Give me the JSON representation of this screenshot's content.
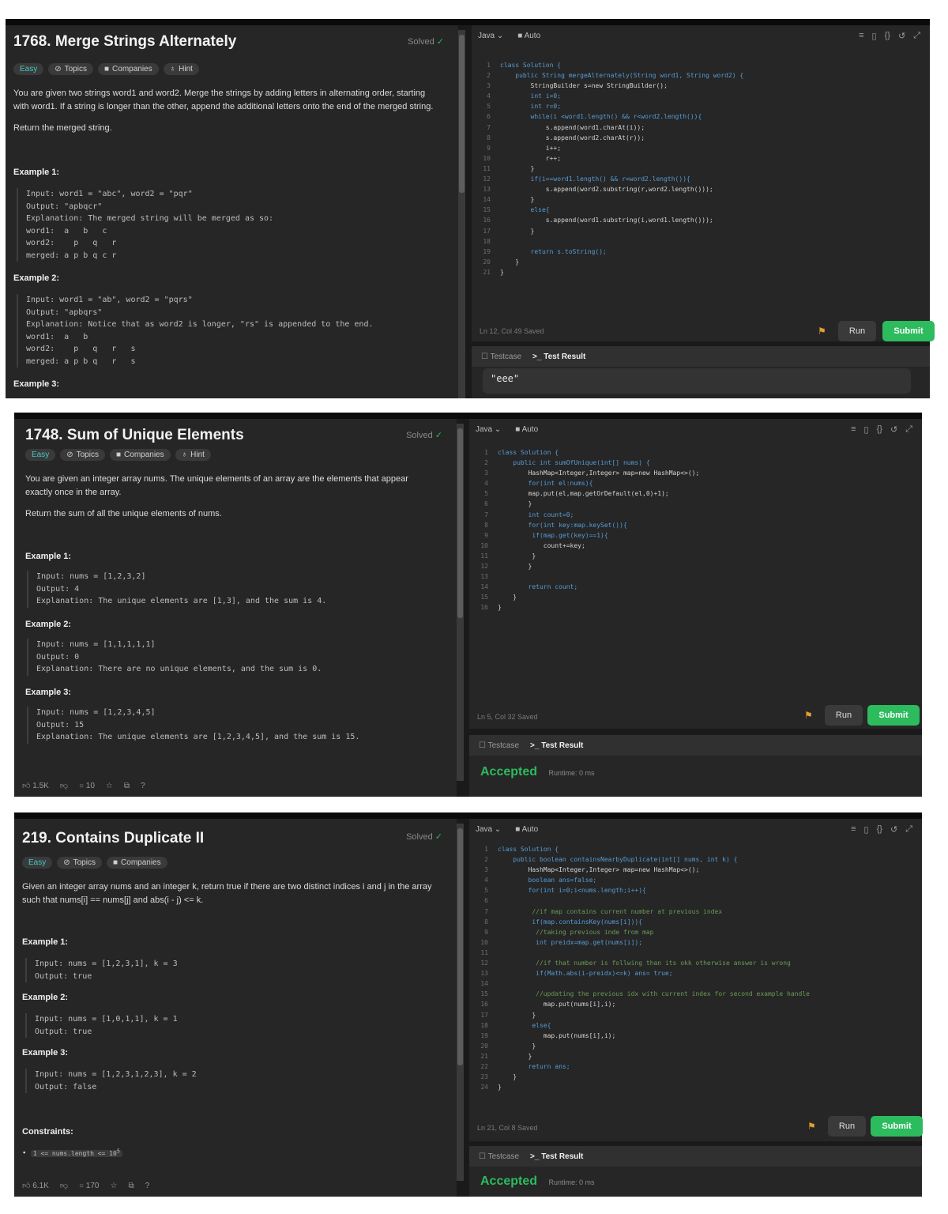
{
  "panels": [
    {
      "problem_title": "1768. Merge Strings Alternately",
      "solved": "Solved",
      "tags": [
        "Easy",
        "Topics",
        "Companies",
        "Hint"
      ],
      "desc1": "You are given two strings word1 and word2. Merge the strings by adding letters in alternating order, starting with word1. If a string is longer than the other, append the additional letters onto the end of the merged string.",
      "desc2": "Return the merged string.",
      "examples": [
        {
          "title": "Example 1:",
          "lines": [
            "Input: word1 = \"abc\", word2 = \"pqr\"",
            "Output: \"apbqcr\"",
            "Explanation: The merged string will be merged as so:",
            "word1:  a   b   c",
            "word2:    p   q   r",
            "merged: a p b q c r"
          ]
        },
        {
          "title": "Example 2:",
          "lines": [
            "Input: word1 = \"ab\", word2 = \"pqrs\"",
            "Output: \"apbqrs\"",
            "Explanation: Notice that as word2 is longer, \"rs\" is appended to the end.",
            "word1:  a   b",
            "word2:    p   q   r   s",
            "merged: a p b q   r   s"
          ]
        },
        {
          "title": "Example 3:",
          "lines": []
        }
      ],
      "language": "Java",
      "mode": "Auto",
      "status": "Ln 12, Col 49  Saved",
      "run": "Run",
      "submit": "Submit",
      "tab_testcase": "Testcase",
      "tab_result": "Test Result",
      "testcase_value": "\"eee\""
    },
    {
      "problem_title": "1748. Sum of Unique Elements",
      "solved": "Solved",
      "tags": [
        "Easy",
        "Topics",
        "Companies",
        "Hint"
      ],
      "desc1": "You are given an integer array nums. The unique elements of an array are the elements that appear exactly once in the array.",
      "desc2": "Return the sum of all the unique elements of nums.",
      "examples": [
        {
          "title": "Example 1:",
          "lines": [
            "Input: nums = [1,2,3,2]",
            "Output: 4",
            "Explanation: The unique elements are [1,3], and the sum is 4."
          ]
        },
        {
          "title": "Example 2:",
          "lines": [
            "Input: nums = [1,1,1,1,1]",
            "Output: 0",
            "Explanation: There are no unique elements, and the sum is 0."
          ]
        },
        {
          "title": "Example 3:",
          "lines": [
            "Input: nums = [1,2,3,4,5]",
            "Output: 15",
            "Explanation: The unique elements are [1,2,3,4,5], and the sum is 15."
          ]
        }
      ],
      "likes": "1.5K",
      "comments": "10",
      "language": "Java",
      "mode": "Auto",
      "status": "Ln 5, Col 32  Saved",
      "run": "Run",
      "submit": "Submit",
      "tab_testcase": "Testcase",
      "tab_result": "Test Result",
      "accepted": "Accepted",
      "runtime": "Runtime: 0 ms"
    },
    {
      "problem_title": "219. Contains Duplicate II",
      "solved": "Solved",
      "tags": [
        "Easy",
        "Topics",
        "Companies"
      ],
      "desc1": "Given an integer array nums and an integer k, return true if there are two distinct indices i and j in the array such that nums[i] == nums[j] and abs(i - j) <= k.",
      "examples": [
        {
          "title": "Example 1:",
          "lines": [
            "Input: nums = [1,2,3,1], k = 3",
            "Output: true"
          ]
        },
        {
          "title": "Example 2:",
          "lines": [
            "Input: nums = [1,0,1,1], k = 1",
            "Output: true"
          ]
        },
        {
          "title": "Example 3:",
          "lines": [
            "Input: nums = [1,2,3,1,2,3], k = 2",
            "Output: false"
          ]
        }
      ],
      "constraints_title": "Constraints:",
      "constraint1": "1 <= nums.length <= 10",
      "constraint1_sup": "5",
      "likes": "6.1K",
      "comments": "170",
      "language": "Java",
      "mode": "Auto",
      "status": "Ln 21, Col 8  Saved",
      "run": "Run",
      "submit": "Submit",
      "tab_testcase": "Testcase",
      "tab_result": "Test Result",
      "accepted": "Accepted",
      "runtime": "Runtime: 0 ms"
    }
  ],
  "code": [
    [
      "class Solution {",
      "    public String mergeAlternately(String word1, String word2) {",
      "        StringBuilder s=new StringBuilder();",
      "        int i=0;",
      "        int r=0;",
      "        while(i <word1.length() && r<word2.length()){",
      "            s.append(word1.charAt(i));",
      "            s.append(word2.charAt(r));",
      "            i++;",
      "            r++;",
      "        }",
      "        if(i==word1.length() && r<word2.length()){",
      "            s.append(word2.substring(r,word2.length()));",
      "        }",
      "        else{",
      "            s.append(word1.substring(i,word1.length()));",
      "        }",
      "",
      "        return s.toString();",
      "    }",
      "}"
    ],
    [
      "class Solution {",
      "    public int sumOfUnique(int[] nums) {",
      "        HashMap<Integer,Integer> map=new HashMap<>();",
      "        for(int el:nums){",
      "        map.put(el,map.getOrDefault(el,0)+1);",
      "        }",
      "        int count=0;",
      "        for(int key:map.keySet()){",
      "         if(map.get(key)==1){",
      "            count+=key;",
      "         }",
      "        }",
      "",
      "        return count;",
      "    }",
      "}"
    ],
    [
      "class Solution {",
      "    public boolean containsNearbyDuplicate(int[] nums, int k) {",
      "        HashMap<Integer,Integer> map=new HashMap<>();",
      "        boolean ans=false;",
      "        for(int i=0;i<nums.length;i++){",
      "",
      "         //if map contains current number at previous index",
      "         if(map.containsKey(nums[i])){",
      "          //taking previous inde from map",
      "          int preidx=map.get(nums[i]);",
      "",
      "          //if that number is follwing than its okk otherwise answer is wrong",
      "          if(Math.abs(i-preidx)<=k) ans= true;",
      "",
      "          //updating the previous idx with current index for second example handle",
      "            map.put(nums[i],i);",
      "         }",
      "         else{",
      "            map.put(nums[i],i);",
      "         }",
      "        }",
      "        return ans;",
      "    }",
      "}"
    ]
  ]
}
